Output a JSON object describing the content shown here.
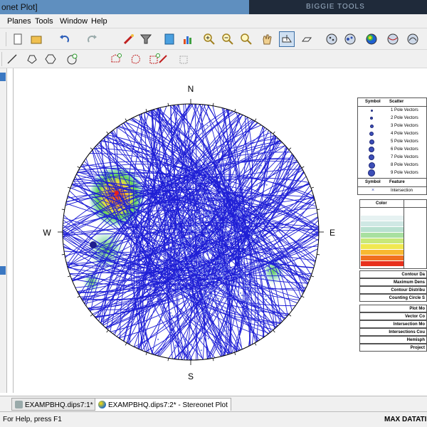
{
  "window": {
    "title": "onet Plot]",
    "right_banner": "BIGGIE TOOLS"
  },
  "menu": [
    "Planes",
    "Tools",
    "Window",
    "Help"
  ],
  "toolbar1": [
    {
      "icon": "undo-icon"
    },
    {
      "icon": "redo-icon"
    },
    {
      "icon": "wand-icon"
    },
    {
      "icon": "filter-icon"
    },
    {
      "icon": "calculator-icon"
    },
    {
      "icon": "chart-icon"
    },
    {
      "icon": "zoom-in-icon"
    },
    {
      "icon": "zoom-out-icon"
    },
    {
      "icon": "zoom-extents-icon"
    },
    {
      "icon": "pan-hand-icon"
    },
    {
      "icon": "select-plane-icon"
    },
    {
      "icon": "eraser-icon"
    },
    {
      "icon": "pole-plot-icon"
    },
    {
      "icon": "scatter-plot-icon"
    },
    {
      "icon": "contour-plot-icon"
    },
    {
      "icon": "major-planes-icon"
    }
  ],
  "toolbar2": [
    {
      "icon": "line-icon"
    },
    {
      "icon": "polyline-icon"
    },
    {
      "icon": "hexagon-icon"
    },
    {
      "icon": "cone-icon"
    },
    {
      "icon": "add-set-icon"
    },
    {
      "icon": "add-window-icon"
    },
    {
      "icon": "add-window-2-icon"
    },
    {
      "icon": "edit-window-icon"
    },
    {
      "icon": "delete-window-icon"
    }
  ],
  "compass": {
    "north": "N",
    "south": "S",
    "east": "E",
    "west": "W"
  },
  "legend": {
    "col_symbol": "Symbol",
    "col_scatter": "Scatter",
    "scatter_rows": [
      "1 Pole Vectors",
      "2 Pole Vectors",
      "3 Pole Vectors",
      "4 Pole Vectors",
      "5 Pole Vectors",
      "6 Pole Vectors",
      "7 Pole Vectors",
      "8 Pole Vectors",
      "9 Pole Vectors"
    ],
    "col_feature": "Feature",
    "feature_row": "Intersection"
  },
  "color_legend": {
    "header": "Color",
    "swatches": [
      "#ffffff",
      "#e6f2f2",
      "#cfe8e4",
      "#b8e0d0",
      "#a8e0a0",
      "#c8e878",
      "#f0e850",
      "#f8b830",
      "#f07020",
      "#e8301c"
    ]
  },
  "info_rows": [
    "Contour Da",
    "Maximum Dens",
    "Contour Distribu",
    "Counting Circle S",
    "Plot Mo",
    "Vector Co",
    "Intersection Mo",
    "Intersections Cou",
    "Hemisph",
    "Project"
  ],
  "tabs": [
    {
      "label": "EXAMPBHQ.dips7:1*",
      "active": false
    },
    {
      "label": "EXAMPBHQ.dips7:2* - Stereonet Plot",
      "active": true
    }
  ],
  "status": {
    "help": "For Help, press F1",
    "user": "MAX DATATII"
  },
  "colors": {
    "plane": "#1f1fd6",
    "pole": "#6f7fe8",
    "net_border": "#000000"
  }
}
